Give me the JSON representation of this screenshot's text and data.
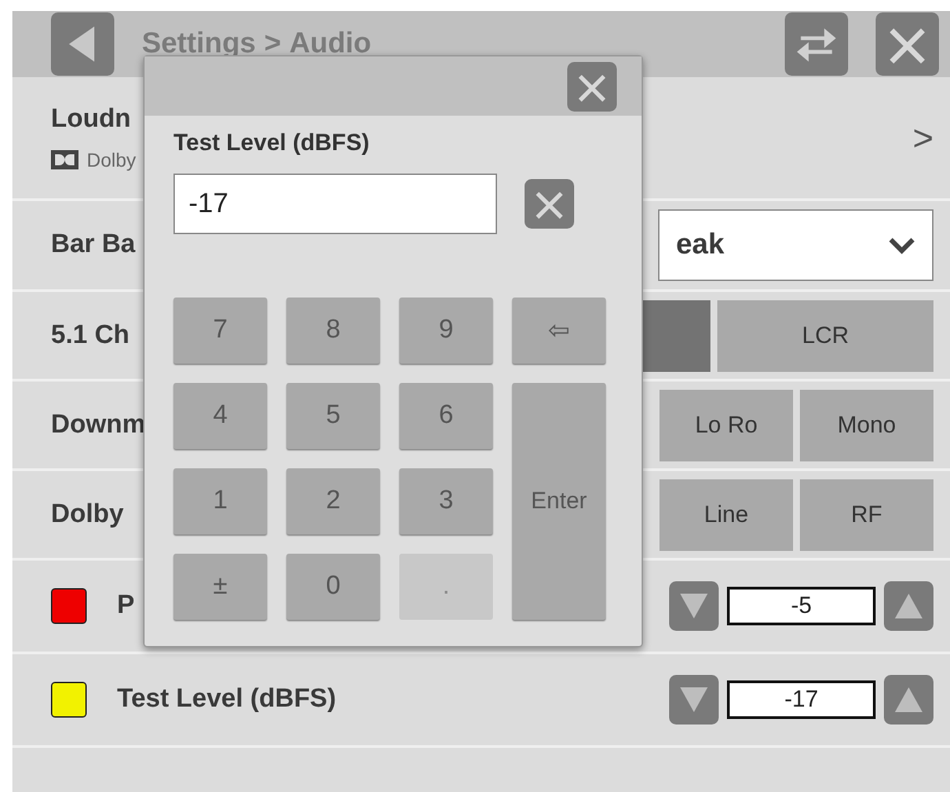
{
  "header": {
    "title": "Settings",
    "separator": ">",
    "subtitle": "Audio"
  },
  "rows": [
    {
      "kind": "nav",
      "label": "Loudn",
      "sublabel": "Dolby",
      "chevron": ">"
    },
    {
      "kind": "dropdown",
      "label": "Bar Ba",
      "value": "eak"
    },
    {
      "kind": "segments",
      "label": "5.1 Ch",
      "segments": [
        {
          "selected": true
        },
        {
          "label": "LCR",
          "selected": false
        }
      ]
    },
    {
      "kind": "segments",
      "label": "Downm",
      "segments": [
        {
          "label": "Lo Ro",
          "selected": false
        },
        {
          "label": "Mono",
          "selected": false
        }
      ]
    },
    {
      "kind": "segments",
      "label": "Dolby",
      "segments": [
        {
          "label": "Line",
          "selected": false
        },
        {
          "label": "RF",
          "selected": false
        }
      ]
    },
    {
      "kind": "level",
      "label": "P",
      "color": "#ee0000",
      "value": "-5"
    },
    {
      "kind": "level",
      "label": "Test Level (dBFS)",
      "color": "#f2f200",
      "value": "-17"
    }
  ],
  "dialog": {
    "label": "Test Level (dBFS)",
    "value": "-17",
    "keys": [
      {
        "label": "7",
        "disabled": false
      },
      {
        "label": "8",
        "disabled": false
      },
      {
        "label": "9",
        "disabled": false
      },
      {
        "label": "⇦",
        "disabled": false,
        "kind": "back"
      },
      {
        "label": "4",
        "disabled": false
      },
      {
        "label": "5",
        "disabled": false
      },
      {
        "label": "6",
        "disabled": false
      },
      {
        "label": "1",
        "disabled": false
      },
      {
        "label": "2",
        "disabled": false
      },
      {
        "label": "3",
        "disabled": false
      },
      {
        "label": "Enter",
        "disabled": false,
        "kind": "enter"
      },
      {
        "label": "±",
        "disabled": false
      },
      {
        "label": "0",
        "disabled": false
      },
      {
        "label": ".",
        "disabled": true
      }
    ]
  }
}
